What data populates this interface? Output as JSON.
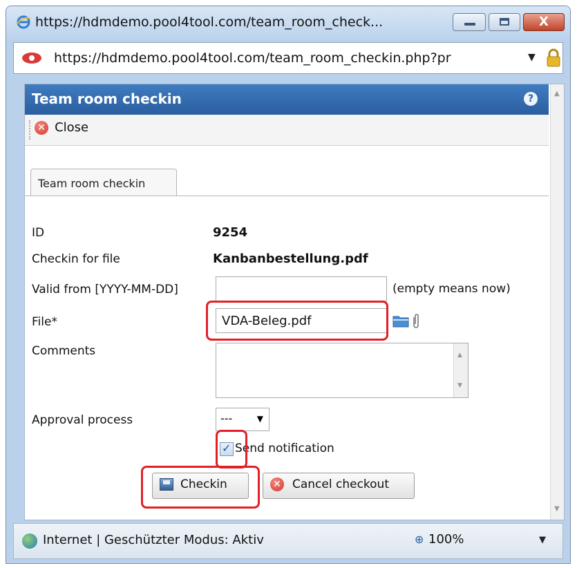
{
  "window": {
    "title": "https://hdmdemo.pool4tool.com/team_room_check...",
    "address": "https://hdmdemo.pool4tool.com/team_room_checkin.php?pr",
    "close_glyph": "X"
  },
  "dialog": {
    "title": "Team room checkin",
    "help_glyph": "?",
    "toolbar": {
      "close_label": "Close"
    },
    "tab": "Team room checkin"
  },
  "form": {
    "id_label": "ID",
    "id_value": "9254",
    "file_for_label": "Checkin for file",
    "file_for_value": "Kanbanbestellung.pdf",
    "valid_from_label": "Valid from [YYYY-MM-DD]",
    "valid_from_value": "",
    "valid_from_hint": "(empty means now)",
    "file_label": "File*",
    "file_value": "VDA-Beleg.pdf",
    "comments_label": "Comments",
    "comments_value": "",
    "approval_label": "Approval process",
    "approval_selected": "---",
    "send_notification_label": "Send notification",
    "send_notification_checked": true,
    "checkin_button": "Checkin",
    "cancel_button": "Cancel checkout"
  },
  "statusbar": {
    "text": "Internet | Geschützter Modus: Aktiv",
    "zoom": "100%"
  },
  "colors": {
    "dialog_header": "#2a5e9f",
    "highlight": "#e21f26",
    "window_frame": "#b9d1ea"
  },
  "icons": [
    "ie-icon",
    "minimize-icon",
    "maximize-icon",
    "close-icon",
    "site-icon",
    "lock-icon",
    "help-icon",
    "close-circle-icon",
    "folder-icon",
    "paperclip-icon",
    "save-disk-icon",
    "cancel-circle-icon",
    "globe-icon",
    "zoom-icon"
  ]
}
